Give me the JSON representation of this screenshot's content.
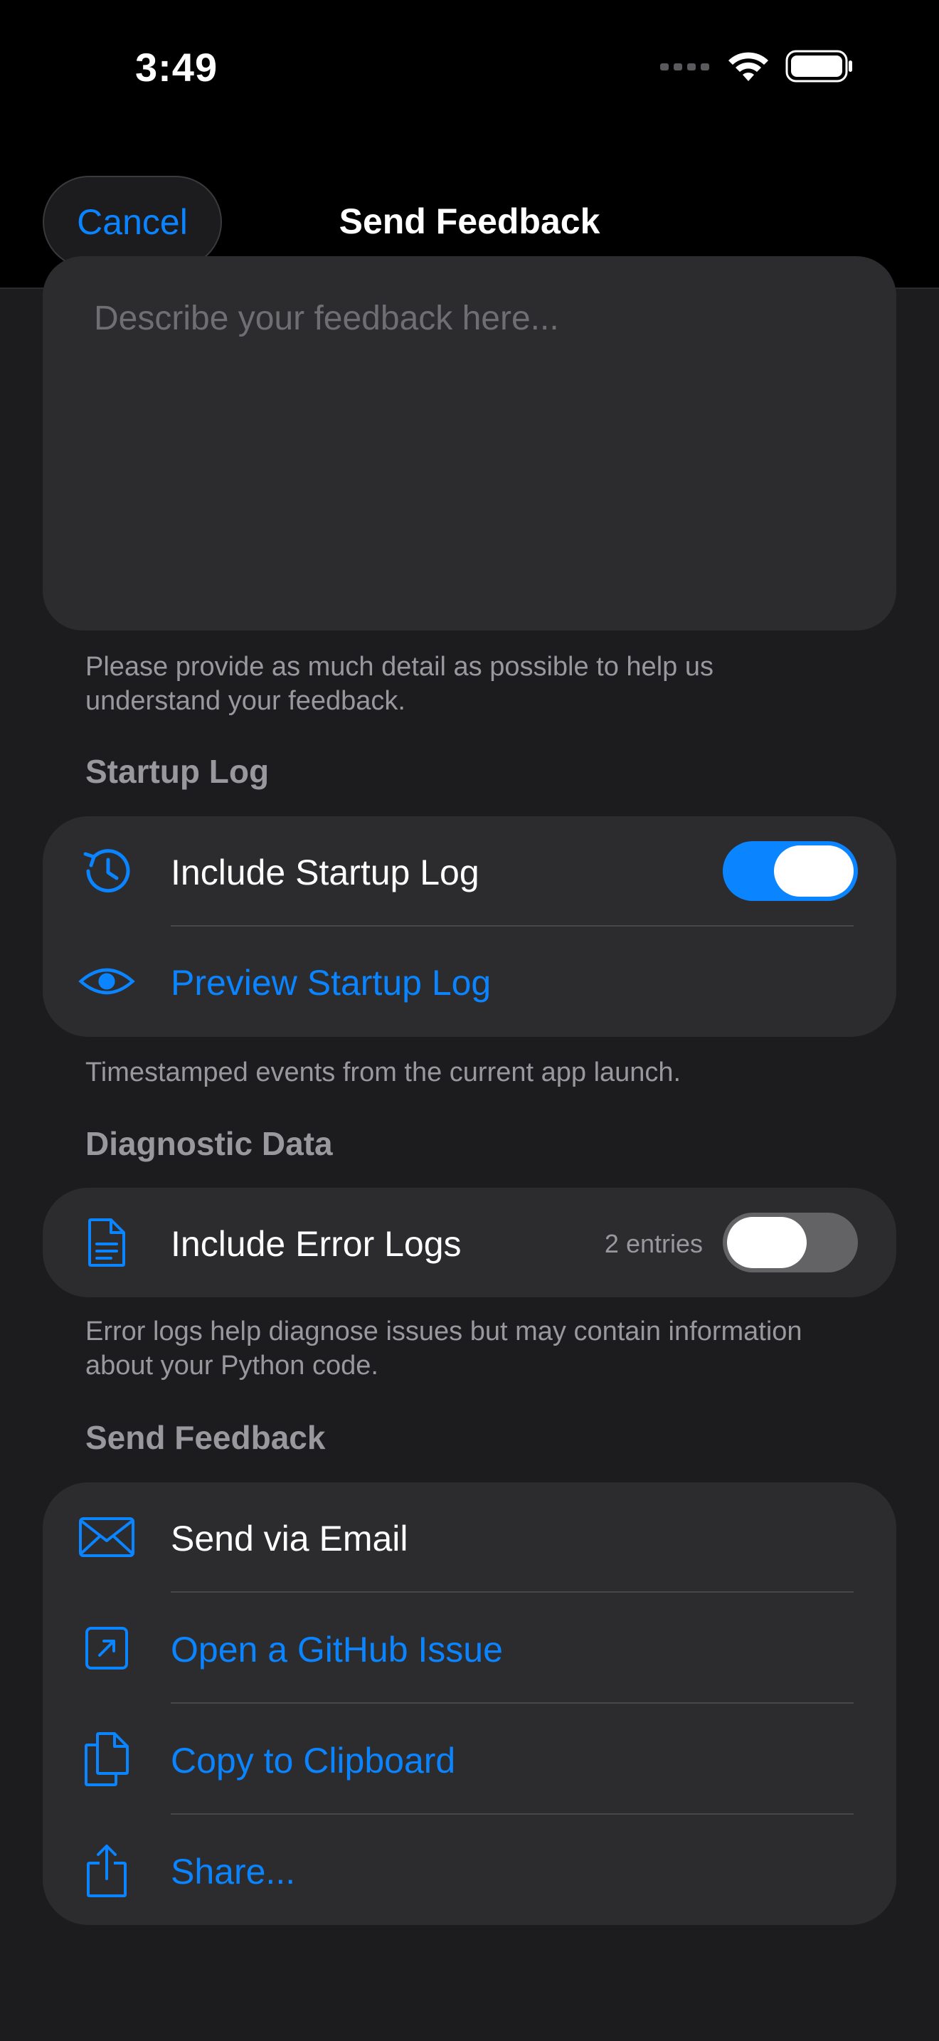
{
  "status": {
    "time": "3:49"
  },
  "nav": {
    "cancel": "Cancel",
    "title": "Send Feedback"
  },
  "feedback": {
    "placeholder": "Describe your feedback here...",
    "caption": "Please provide as much detail as possible to help us understand your feedback."
  },
  "startup_log": {
    "header": "Startup Log",
    "include_label": "Include Startup Log",
    "include_on": true,
    "preview_label": "Preview Startup Log",
    "caption": "Timestamped events from the current app launch."
  },
  "diagnostic": {
    "header": "Diagnostic Data",
    "include_label": "Include Error Logs",
    "count": "2 entries",
    "include_on": false,
    "caption": "Error logs help diagnose issues but may contain information about your Python code."
  },
  "send": {
    "header": "Send Feedback",
    "items": [
      {
        "label": "Send via Email",
        "icon": "envelope-icon"
      },
      {
        "label": "Open a GitHub Issue",
        "icon": "external-link-icon"
      },
      {
        "label": "Copy to Clipboard",
        "icon": "copy-icon"
      },
      {
        "label": "Share...",
        "icon": "share-icon"
      }
    ]
  },
  "colors": {
    "accent": "#0a84ff",
    "background": "#1c1c1e",
    "card": "#2c2c2e"
  }
}
